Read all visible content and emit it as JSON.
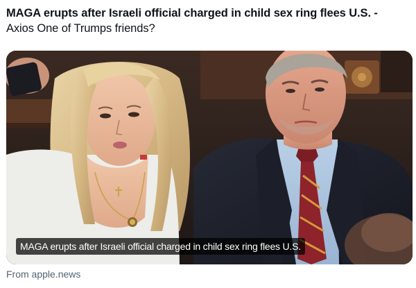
{
  "post": {
    "headline": "MAGA erupts after Israeli official charged in child sex ring flees U.S. -",
    "rest": "Axios One of Trumps friends?"
  },
  "card": {
    "caption": "MAGA erupts after Israeli official charged in child sex ring flees U.S.",
    "source": "From apple.news"
  },
  "colors": {
    "text": "#0f1419",
    "secondary_text": "#536471",
    "caption_bg": "#000000b8"
  }
}
